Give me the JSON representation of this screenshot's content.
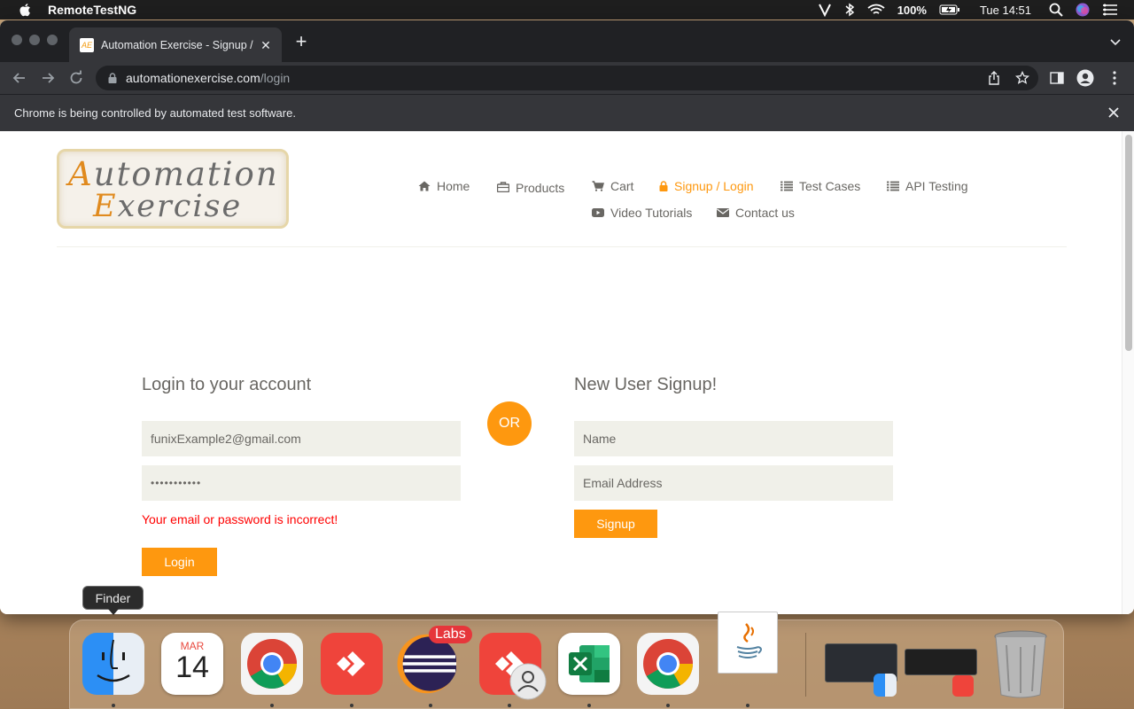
{
  "menubar": {
    "app_name": "RemoteTestNG",
    "battery": "100%",
    "clock": "Tue 14:51"
  },
  "browser": {
    "tab_title": "Automation Exercise - Signup / Login",
    "tab_favicon_text": "AE",
    "url_domain": "automationexercise.com",
    "url_path": "/login",
    "infobar_text": "Chrome is being controlled by automated test software."
  },
  "site": {
    "logo_line1_cap": "A",
    "logo_line1_rest": "utomation",
    "logo_line2_cap": "E",
    "logo_line2_rest": "xercise",
    "nav": {
      "home": "Home",
      "products": "Products",
      "cart": "Cart",
      "signup_login": "Signup / Login",
      "test_cases": "Test Cases",
      "api_testing": "API Testing",
      "video_tutorials": "Video Tutorials",
      "contact_us": "Contact us"
    },
    "accent_color": "#fe980f"
  },
  "login": {
    "title": "Login to your account",
    "email_value": "funixExample2@gmail.com",
    "password_value": "•••••••••••",
    "error": "Your email or password is incorrect!",
    "button": "Login"
  },
  "or_label": "OR",
  "signup": {
    "title": "New User Signup!",
    "name_placeholder": "Name",
    "email_placeholder": "Email Address",
    "button": "Signup"
  },
  "dock": {
    "tooltip": "Finder",
    "calendar_month": "MAR",
    "calendar_day": "14",
    "eclipse_badge": "Labs"
  }
}
